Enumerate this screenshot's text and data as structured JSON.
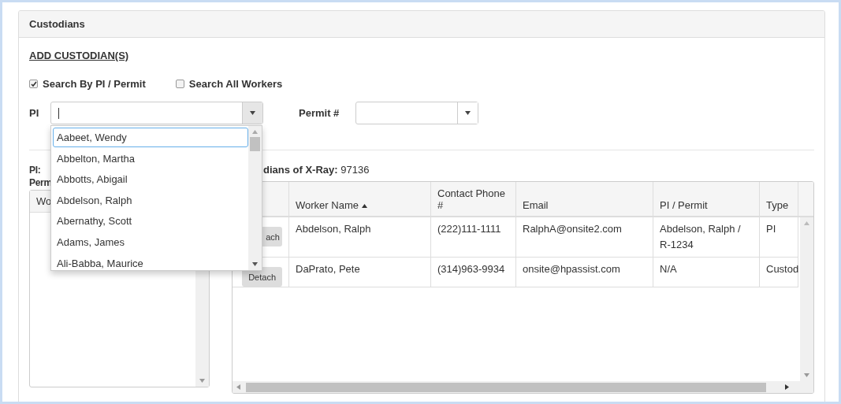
{
  "panel": {
    "title": "Custodians"
  },
  "add_link": "ADD CUSTODIAN(S)",
  "search_modes": [
    {
      "label": "Search By PI / Permit",
      "checked": true
    },
    {
      "label": "Search All Workers",
      "checked": false
    }
  ],
  "pi_field": {
    "label": "PI"
  },
  "pi_dropdown": {
    "items": [
      {
        "label": "Aabeet, Wendy",
        "selected": true
      },
      {
        "label": "Abbelton, Martha",
        "selected": false
      },
      {
        "label": "Abbotts, Abigail",
        "selected": false
      },
      {
        "label": "Abdelson, Ralph",
        "selected": false
      },
      {
        "label": "Abernathy, Scott",
        "selected": false
      },
      {
        "label": "Adams, James",
        "selected": false
      },
      {
        "label": "Ali-Babba, Maurice",
        "selected": false
      }
    ]
  },
  "permit_field": {
    "label": "Permit #"
  },
  "pi_info": {
    "pi_label": "PI:",
    "permit_label": "Perm"
  },
  "workers_list": {
    "header": "Wo"
  },
  "custodians": {
    "heading": "dians of X-Ray:",
    "value": "97136",
    "columns": [
      {
        "label": "Worker Name",
        "sorted": true
      },
      {
        "label": "Contact Phone #",
        "sorted": false
      },
      {
        "label": "Email",
        "sorted": false
      },
      {
        "label": "PI / Permit",
        "sorted": false
      },
      {
        "label": "Type",
        "sorted": false
      }
    ],
    "rows": [
      {
        "action": "ach",
        "cells": [
          "Abdelson, Ralph",
          "(222)111-1111",
          "RalphA@onsite2.com",
          "Abdelson, Ralph / R-1234",
          "PI"
        ]
      },
      {
        "action": "Detach",
        "cells": [
          "DaPrato, Pete",
          "(314)963-9934",
          "onsite@hpassist.com",
          "N/A",
          "Custod"
        ]
      }
    ]
  }
}
